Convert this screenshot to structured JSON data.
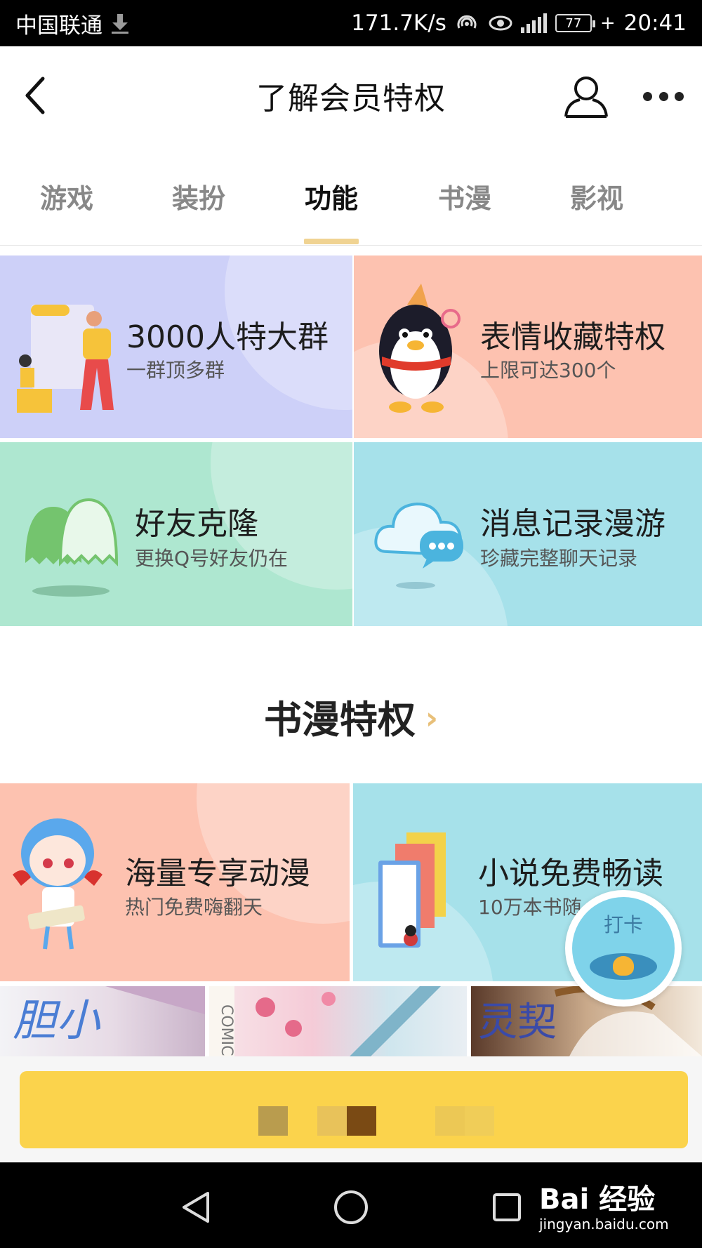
{
  "status_bar": {
    "carrier": "中国联通",
    "speed": "171.7K/s",
    "battery": "77",
    "time": "20:41"
  },
  "header": {
    "title": "了解会员特权",
    "back_icon": "chevron-left-icon",
    "user_icon": "user-outline-icon",
    "more_icon": "more-dots-icon"
  },
  "tabs": [
    {
      "label": "游戏",
      "active": false
    },
    {
      "label": "装扮",
      "active": false
    },
    {
      "label": "功能",
      "active": true
    },
    {
      "label": "书漫",
      "active": false
    },
    {
      "label": "影视",
      "active": false
    }
  ],
  "feature_cards": [
    {
      "title": "3000人特大群",
      "subtitle": "一群顶多群",
      "color": "#cdd0f8"
    },
    {
      "title": "表情收藏特权",
      "subtitle": "上限可达300个",
      "color": "#fdc2b0"
    },
    {
      "title": "好友克隆",
      "subtitle": "更换Q号好友仍在",
      "color": "#aee7d0"
    },
    {
      "title": "消息记录漫游",
      "subtitle": "珍藏完整聊天记录",
      "color": "#a6e1ea"
    }
  ],
  "comic_section": {
    "title": "书漫特权",
    "cards": [
      {
        "title": "海量专享动漫",
        "subtitle": "热门免费嗨翻天",
        "color": "#fdc2b0"
      },
      {
        "title": "小说免费畅读",
        "subtitle": "10万本书随",
        "color": "#a6e1ea"
      }
    ]
  },
  "checkin": {
    "label": "打卡"
  },
  "cta": {
    "color": "#fbd34c"
  },
  "watermark": {
    "brand": "Bai 经验",
    "url": "jingyan.baidu.com"
  }
}
